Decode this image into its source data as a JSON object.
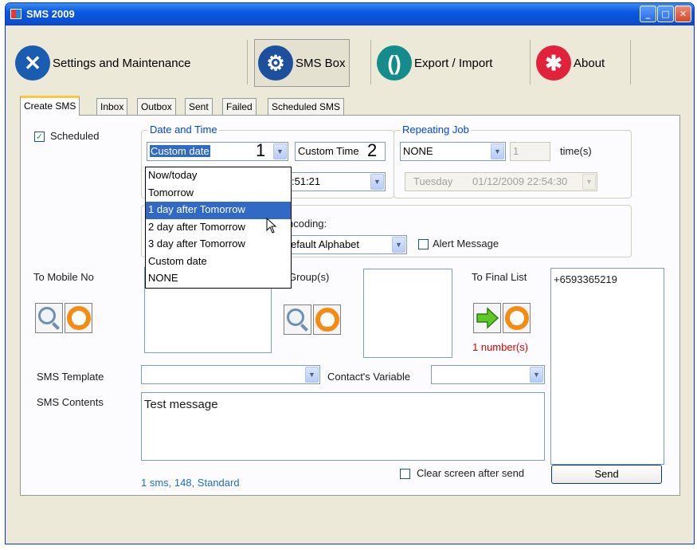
{
  "window": {
    "title": "SMS 2009",
    "minimize": "_",
    "maximize": "□",
    "close": "✕"
  },
  "toolbar": {
    "items": [
      {
        "label": "Settings and Maintenance",
        "icon": "tools-icon"
      },
      {
        "label": "SMS Box",
        "icon": "gear-icon"
      },
      {
        "label": "Export / Import",
        "icon": "sync-icon"
      },
      {
        "label": "About",
        "icon": "about-icon"
      }
    ]
  },
  "tabs": [
    "Create SMS",
    "Inbox",
    "Outbox",
    "Sent",
    "Failed",
    "Scheduled SMS"
  ],
  "form": {
    "scheduled_label": "Scheduled",
    "scheduled_checked": true,
    "date_time_group": "Date and Time",
    "date_value": "Custom date",
    "date_marker": "1",
    "time_value": "Custom Time",
    "time_marker": "2",
    "time_clock": ":51:21",
    "repeating_group": "Repeating Job",
    "repeat_value": "NONE",
    "repeat_count": "1",
    "repeat_unit": "time(s)",
    "repeat_day": "Tuesday",
    "repeat_datetime": "01/12/2009 22:54:30",
    "encoding_label": "ncoding:",
    "encoding_value": "efault Alphabet",
    "alert_label": "Alert Message",
    "to_mobile_label": "To Mobile No",
    "to_group_label": "Group(s)",
    "to_final_label": "To Final List",
    "final_count": "1 number(s)",
    "final_list": [
      "+6593365219"
    ],
    "template_label": "SMS Template",
    "variable_label": "Contact's Variable",
    "contents_label": "SMS Contents",
    "contents_value": "Test message",
    "clear_label": "Clear screen after send",
    "send_label": "Send",
    "status": "1 sms, 148, Standard"
  },
  "date_dropdown": {
    "options": [
      "Now/today",
      "Tomorrow",
      "1 day after Tomorrow",
      "2 day after Tomorrow",
      "3 day after Tomorrow",
      "Custom date",
      "NONE"
    ],
    "highlighted_index": 2
  },
  "colors": {
    "title_blue": "#0b58e0",
    "group_title": "#0046d5",
    "selection": "#316ac5",
    "red_text": "#e00000",
    "status_blue": "#1c6ec8",
    "arrow_green": "#5fc828",
    "refresh_orange": "#f48c14"
  }
}
